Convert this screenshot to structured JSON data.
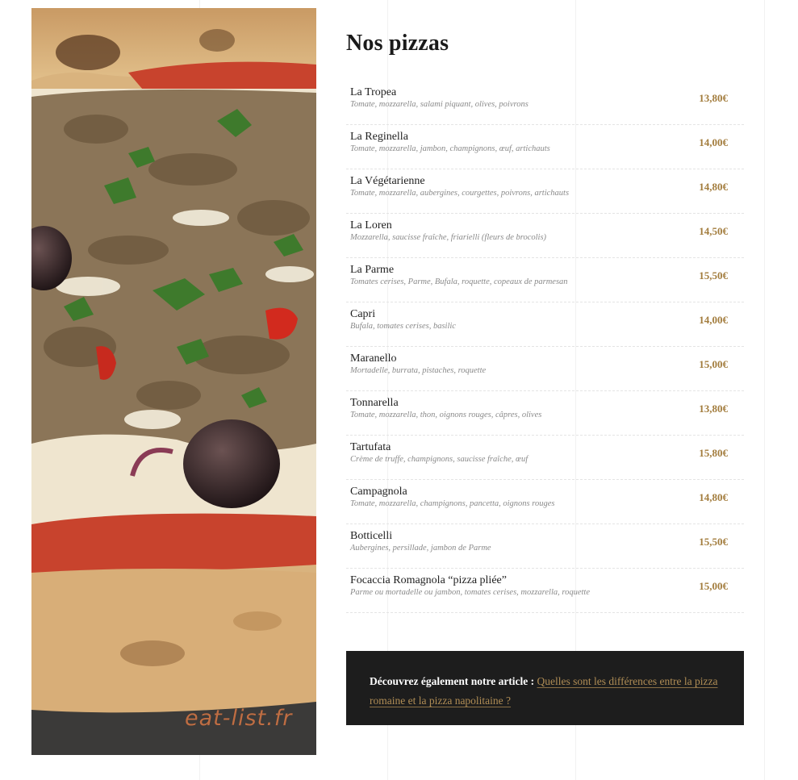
{
  "photo": {
    "alt": "pizza close-up",
    "watermark": "eat-list.fr"
  },
  "menu": {
    "title": "Nos pizzas",
    "items": [
      {
        "name": "La Tropea",
        "desc": "Tomate, mozzarella, salami piquant, olives, poivrons",
        "price": "13,80€"
      },
      {
        "name": "La Reginella",
        "desc": "Tomate, mozzarella, jambon, champignons, œuf, artichauts",
        "price": "14,00€"
      },
      {
        "name": "La Végétarienne",
        "desc": "Tomate, mozzarella, aubergines, courgettes, poivrons, artichauts",
        "price": "14,80€"
      },
      {
        "name": "La Loren",
        "desc": "Mozzarella, saucisse fraîche, friarielli (fleurs de brocolis)",
        "price": "14,50€"
      },
      {
        "name": "La Parme",
        "desc": "Tomates cerises, Parme, Bufala, roquette, copeaux de parmesan",
        "price": "15,50€"
      },
      {
        "name": "Capri",
        "desc": "Bufala, tomates cerises, basilic",
        "price": "14,00€"
      },
      {
        "name": "Maranello",
        "desc": "Mortadelle, burrata, pistaches, roquette",
        "price": "15,00€"
      },
      {
        "name": "Tonnarella",
        "desc": "Tomate, mozzarella, thon, oignons rouges, câpres, olives",
        "price": "13,80€"
      },
      {
        "name": "Tartufata",
        "desc": "Crème de truffe, champignons, saucisse fraîche, œuf",
        "price": "15,80€"
      },
      {
        "name": "Campagnola",
        "desc": "Tomate, mozzarella, champignons, pancetta, oignons rouges",
        "price": "14,80€"
      },
      {
        "name": "Botticelli",
        "desc": "Aubergines, persillade, jambon de Parme",
        "price": "15,50€"
      },
      {
        "name": "Focaccia Romagnola “pizza pliée”",
        "desc": "Parme ou mortadelle ou jambon, tomates cerises, mozzarella, roquette",
        "price": "15,00€"
      }
    ]
  },
  "article": {
    "lead": "Découvrez également notre article :",
    "link_text": "Quelles sont les différences entre la pizza romaine et la pizza napolitaine ?"
  },
  "colors": {
    "price": "#a37d3e",
    "link": "#b08d55",
    "article_bg": "#1d1d1d"
  }
}
